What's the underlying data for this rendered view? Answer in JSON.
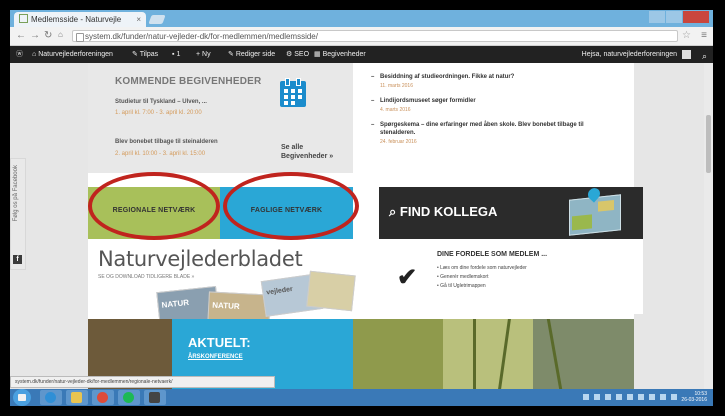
{
  "browser": {
    "tab_title": "Medlemsside - Naturvejle",
    "address": "system.dk/funder/natur-vejleder-dk/for-medlemmen/medlemsside/"
  },
  "adminbar": {
    "site": "Naturvejlederforeningen",
    "tips": "Tilpas",
    "comments": "1",
    "new": "+ Ny",
    "edit": "Rediger side",
    "seo": "SEO",
    "apps": "Begivenheder",
    "greeting": "Hejsa, naturvejlederforeningen"
  },
  "events": {
    "heading": "KOMMENDE BEGIVENHEDER",
    "items": [
      {
        "title": "Studietur til Tyskland – Ulven, ... ",
        "date": "1. april kl. 7:00 - 3. april kl. 20:00"
      },
      {
        "title": "Blev bonebet tilbage til steinalderen",
        "date": "2. april kl. 10:00 - 3. april kl. 15:00"
      }
    ],
    "see_all": "Se alle\nBegivenheder »"
  },
  "news": {
    "items": [
      {
        "title": "Besiddning af studieordningen. Fikke at natur?",
        "date": "11. marts 2016"
      },
      {
        "title": "Lindijordsmuseet søger formidler",
        "date": "4. marts 2016"
      },
      {
        "title": "Spørgeskema – dine erfaringer med åben skole. Blev bonebet tilbage til stenalderen.",
        "date": "24. februar 2016"
      }
    ]
  },
  "networks": {
    "regional": "REGIONALE NETVÆRK",
    "faglige": "FAGLIGE NETVÆRK"
  },
  "find_kollega": "FIND KOLLEGA",
  "magazine": {
    "title": "Naturvejlederbladet",
    "subtitle": "SE OG DOWNLOAD TIDLIGERE BLADE »"
  },
  "benefits": {
    "heading": "DINE FORDELE SOM MEDLEM ...",
    "items": [
      "Læs om dine fordele som naturvejleder",
      "Generér medlemskort",
      "Gå til Ugletrimappen"
    ]
  },
  "aktuelt": {
    "title": "AKTUELT:",
    "subtitle": "ÅRSKONFERENCE"
  },
  "facebook_side": "Følg os på Facebook",
  "status_url": "system.dk/funder/natur-vejleder-dk/for-medlemmen/regionale-netvaerk/",
  "clock": {
    "time": "10:53",
    "date": "26-03-2016"
  },
  "colors": {
    "regional_green": "#a8c05a",
    "faglige_blue": "#2aa7d6",
    "highlight_red": "#c0241e",
    "dark_banner": "#2b2b2b"
  }
}
